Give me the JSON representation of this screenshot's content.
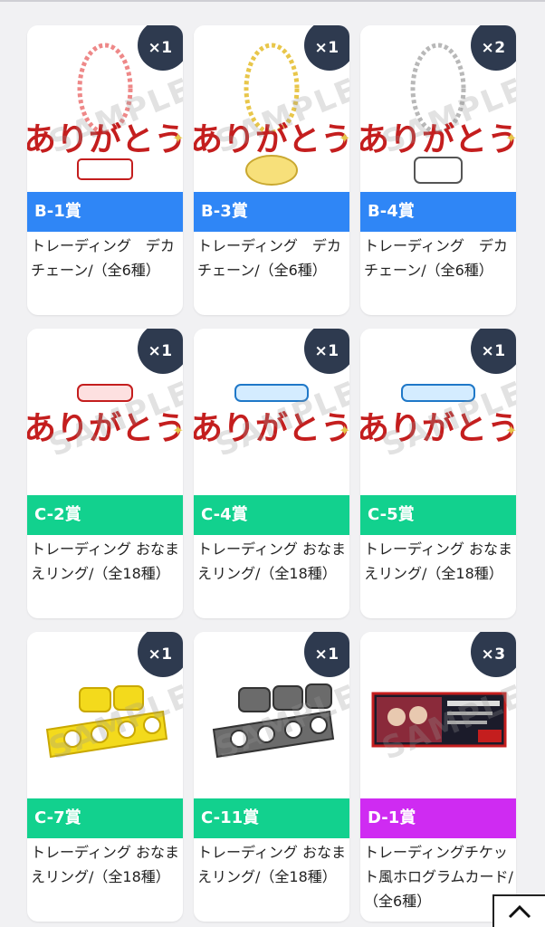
{
  "colors": {
    "tag_b": "#2f86f6",
    "tag_c": "#12d18e",
    "tag_d": "#cf2bf2",
    "badge": "#2e3a4f"
  },
  "watermark": "SAMPLE",
  "cards": [
    {
      "count": "×1",
      "tag": "B-1賞",
      "desc": "トレーディング　デカチェーン/（全6種）",
      "tag_color": "#2f86f6",
      "art": "chain-keychain",
      "logo_text": "ありがとう"
    },
    {
      "count": "×1",
      "tag": "B-3賞",
      "desc": "トレーディング　デカチェーン/（全6種）",
      "tag_color": "#2f86f6",
      "art": "chain-keychain",
      "logo_text": "ありがとう"
    },
    {
      "count": "×2",
      "tag": "B-4賞",
      "desc": "トレーディング　デカチェーン/（全6種）",
      "tag_color": "#2f86f6",
      "art": "chain-keychain",
      "logo_text": "ありがとう"
    },
    {
      "count": "×1",
      "tag": "C-2賞",
      "desc": "トレーディング おなまえリング/（全18種）",
      "tag_color": "#12d18e",
      "art": "name-logo",
      "logo_text": "ありがとう"
    },
    {
      "count": "×1",
      "tag": "C-4賞",
      "desc": "トレーディング おなまえリング/（全18種）",
      "tag_color": "#12d18e",
      "art": "name-logo",
      "logo_text": "ありがとう"
    },
    {
      "count": "×1",
      "tag": "C-5賞",
      "desc": "トレーディング おなまえリング/（全18種）",
      "tag_color": "#12d18e",
      "art": "name-logo",
      "logo_text": "ありがとう"
    },
    {
      "count": "×1",
      "tag": "C-7賞",
      "desc": "トレーディング おなまえリング/（全18種）",
      "tag_color": "#12d18e",
      "art": "ring-yellow"
    },
    {
      "count": "×1",
      "tag": "C-11賞",
      "desc": "トレーディング おなまえリング/（全18種）",
      "tag_color": "#12d18e",
      "art": "ring-gray"
    },
    {
      "count": "×3",
      "tag": "D-1賞",
      "desc": "トレーディングチケット風ホログラムカード/（全6種）",
      "tag_color": "#cf2bf2",
      "art": "hologram-card"
    }
  ],
  "scroll_top_icon": "chevron-up-icon"
}
